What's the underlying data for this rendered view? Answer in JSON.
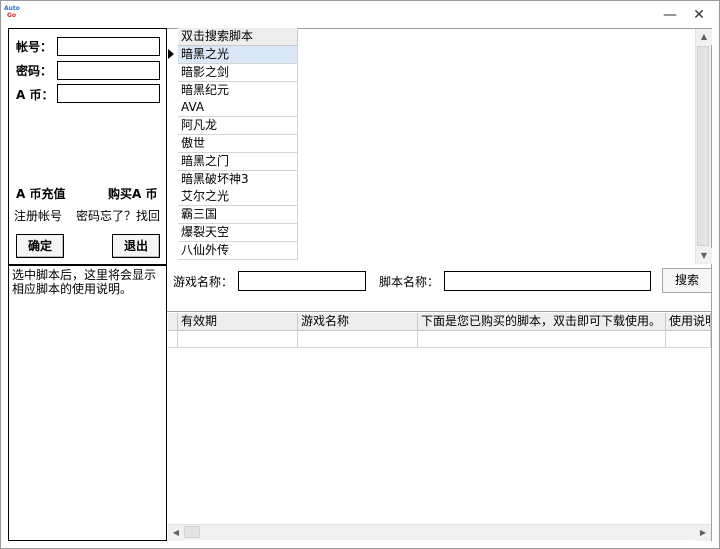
{
  "app": {
    "logo_line1": "Auto",
    "logo_line2": "Go",
    "minimize_glyph": "—",
    "close_glyph": "✕"
  },
  "login": {
    "account_label": "帐号：",
    "password_label": "密码：",
    "coin_label": "A 币：",
    "account_value": "",
    "password_value": "",
    "coin_value": "",
    "recharge_link": "A 币充值",
    "buy_link": "购买A 币",
    "register_link": "注册帐号",
    "forgot_link": "密码忘了？找回",
    "ok_button": "确定",
    "exit_button": "退出"
  },
  "script_list": {
    "header": "双击搜索脚本",
    "selected_index": 0,
    "items": [
      "暗黑之光",
      "暗影之剑",
      "暗黑纪元",
      "AVA",
      "阿凡龙",
      "傲世",
      "暗黑之门",
      "暗黑破坏神3",
      "艾尔之光",
      "霸三国",
      "爆裂天空",
      "八仙外传"
    ]
  },
  "description": {
    "text": "选中脚本后，这里将会显示相应脚本的使用说明。"
  },
  "search": {
    "game_name_label": "游戏名称：",
    "script_name_label": "脚本名称：",
    "game_name_value": "",
    "script_name_value": "",
    "search_button": "搜索"
  },
  "purchased": {
    "columns": [
      "有效期",
      "游戏名称",
      "下面是您已购买的脚本，双击即可下载使用。",
      "使用说明"
    ]
  },
  "colors": {
    "selected_row": "#d9e7f7",
    "header_bg": "#eeeeee",
    "border": "#000000"
  }
}
